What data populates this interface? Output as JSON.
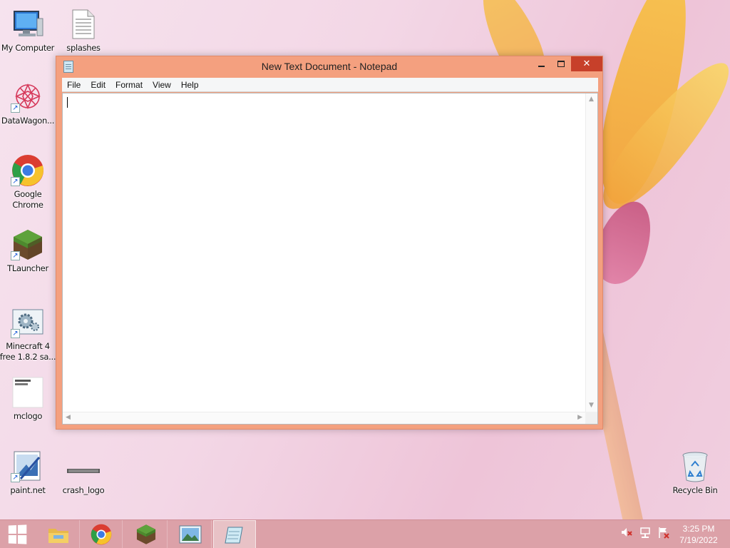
{
  "desktop": {
    "icons": [
      {
        "label": "My Computer"
      },
      {
        "label": "splashes"
      },
      {
        "label": "DataWagon..."
      },
      {
        "label": "Google Chrome"
      },
      {
        "label": "TLauncher"
      },
      {
        "label": "Minecraft 4 free 1.8.2 sa..."
      },
      {
        "label": "mclogo"
      },
      {
        "label": "paint.net"
      },
      {
        "label": "crash_logo"
      },
      {
        "label": "Recycle Bin"
      }
    ]
  },
  "notepad": {
    "title": "New Text Document - Notepad",
    "close_glyph": "✕",
    "menu": [
      "File",
      "Edit",
      "Format",
      "View",
      "Help"
    ],
    "content": ""
  },
  "taskbar": {
    "time": "3:25 PM",
    "date": "7/19/2022"
  },
  "colors": {
    "window_frame": "#f4a07f",
    "close_button": "#c7402a",
    "taskbar": "#dca1a8"
  }
}
